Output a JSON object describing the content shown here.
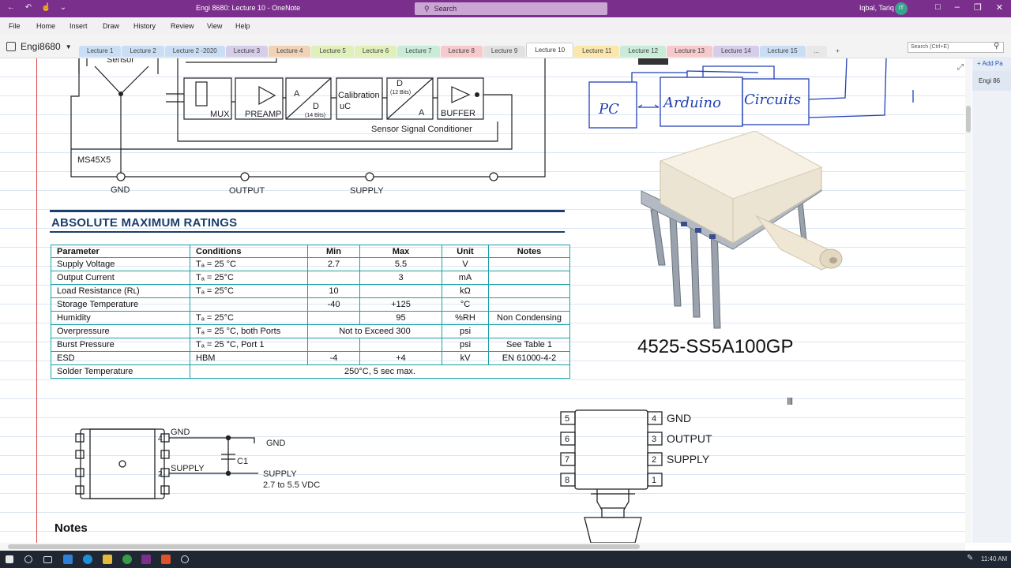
{
  "window": {
    "title": "Engi 8680: Lecture 10 - OneNote",
    "search_placeholder": "Search",
    "user": "Iqbal, Tariq",
    "avatar_initials": "IT"
  },
  "menu": [
    "File",
    "Home",
    "Insert",
    "Draw",
    "History",
    "Review",
    "View",
    "Help"
  ],
  "notebook": {
    "name": "Engi8680"
  },
  "tabs": [
    {
      "label": "Lecture 1",
      "color": "#c9def5"
    },
    {
      "label": "Lecture 2",
      "color": "#c9def5"
    },
    {
      "label": "Lecture 2 -2020",
      "color": "#c9def5"
    },
    {
      "label": "Lecture 3",
      "color": "#d6cdea"
    },
    {
      "label": "Lecture 4",
      "color": "#f0d3b6"
    },
    {
      "label": "Lecture 5",
      "color": "#dff0b8"
    },
    {
      "label": "Lecture 6",
      "color": "#dff0b8"
    },
    {
      "label": "Lecture 7",
      "color": "#c8ecd7"
    },
    {
      "label": "Lecture 8",
      "color": "#f6c9cc"
    },
    {
      "label": "Lecture 9",
      "color": "#e1e1e1"
    },
    {
      "label": "Lecture 10",
      "color": "#c9def5"
    },
    {
      "label": "Lecture 11",
      "color": "#fbe7a9"
    },
    {
      "label": "Lecture 12",
      "color": "#c8ecd7"
    },
    {
      "label": "Lecture 13",
      "color": "#f6c9cc"
    },
    {
      "label": "Lecture 14",
      "color": "#d6cdea"
    },
    {
      "label": "Lecture 15",
      "color": "#c9def5"
    },
    {
      "label": "...",
      "color": "#e8e8e8"
    },
    {
      "label": "+",
      "color": "#f3f3f3"
    }
  ],
  "page_search_placeholder": "Search (Ctrl+E)",
  "add_page": "Add Pa",
  "pages": [
    "Engi 86"
  ],
  "diagram": {
    "sensor": "Sensor",
    "blocks": [
      "MUX",
      "PREAMP",
      "A",
      "D",
      "(14 Bits)",
      "Calibration",
      "uC",
      "D",
      "(12 Bits)",
      "A",
      "BUFFER"
    ],
    "conditioner": "Sensor  Signal  Conditioner",
    "chip": "MS45X5",
    "pins": [
      "GND",
      "OUTPUT",
      "SUPPLY"
    ]
  },
  "sketch": {
    "pc": "PC",
    "arduino": "Arduino",
    "circuits": "Circuits"
  },
  "section_title": "ABSOLUTE MAXIMUM RATINGS",
  "table": {
    "headers": [
      "Parameter",
      "Conditions",
      "Min",
      "Max",
      "Unit",
      "Notes"
    ],
    "rows": [
      [
        "Supply Voltage",
        "Tₐ = 25 °C",
        "2.7",
        "5.5",
        "V",
        ""
      ],
      [
        "Output Current",
        "Tₐ = 25°C",
        "",
        "3",
        "mA",
        ""
      ],
      [
        "Load Resistance (Rʟ)",
        "Tₐ = 25°C",
        "10",
        "",
        "kΩ",
        ""
      ],
      [
        "Storage Temperature",
        "",
        "-40",
        "+125",
        "°C",
        ""
      ],
      [
        "Humidity",
        "Tₐ = 25°C",
        "",
        "95",
        "%RH",
        "Non Condensing"
      ],
      [
        "Overpressure",
        "Tₐ = 25 °C, both Ports",
        "Not to Exceed 300",
        "",
        "psi",
        ""
      ],
      [
        "Burst Pressure",
        "Tₐ = 25 °C, Port 1",
        "",
        "",
        "psi",
        "See Table 1"
      ],
      [
        "ESD",
        "HBM",
        "-4",
        "+4",
        "kV",
        "EN 61000-4-2"
      ],
      [
        "Solder Temperature",
        "250°C, 5 sec max.",
        "",
        "",
        "",
        ""
      ]
    ]
  },
  "part_number": "4525-SS5A100GP",
  "wiring": {
    "gnd_pin": "GND",
    "supply_pin": "SUPPLY",
    "gnd": "GND",
    "cap": "C1",
    "supply": "SUPPLY",
    "supply_range": "2.7  to  5.5  VDC",
    "pin4": "4",
    "pin2": "2"
  },
  "pinout": {
    "left": [
      "5",
      "6",
      "7",
      "8"
    ],
    "right": [
      "4",
      "3",
      "2",
      "1"
    ],
    "labels": [
      "GND",
      "OUTPUT",
      "SUPPLY"
    ]
  },
  "notes_heading": "Notes",
  "clock": "11:40 AM"
}
